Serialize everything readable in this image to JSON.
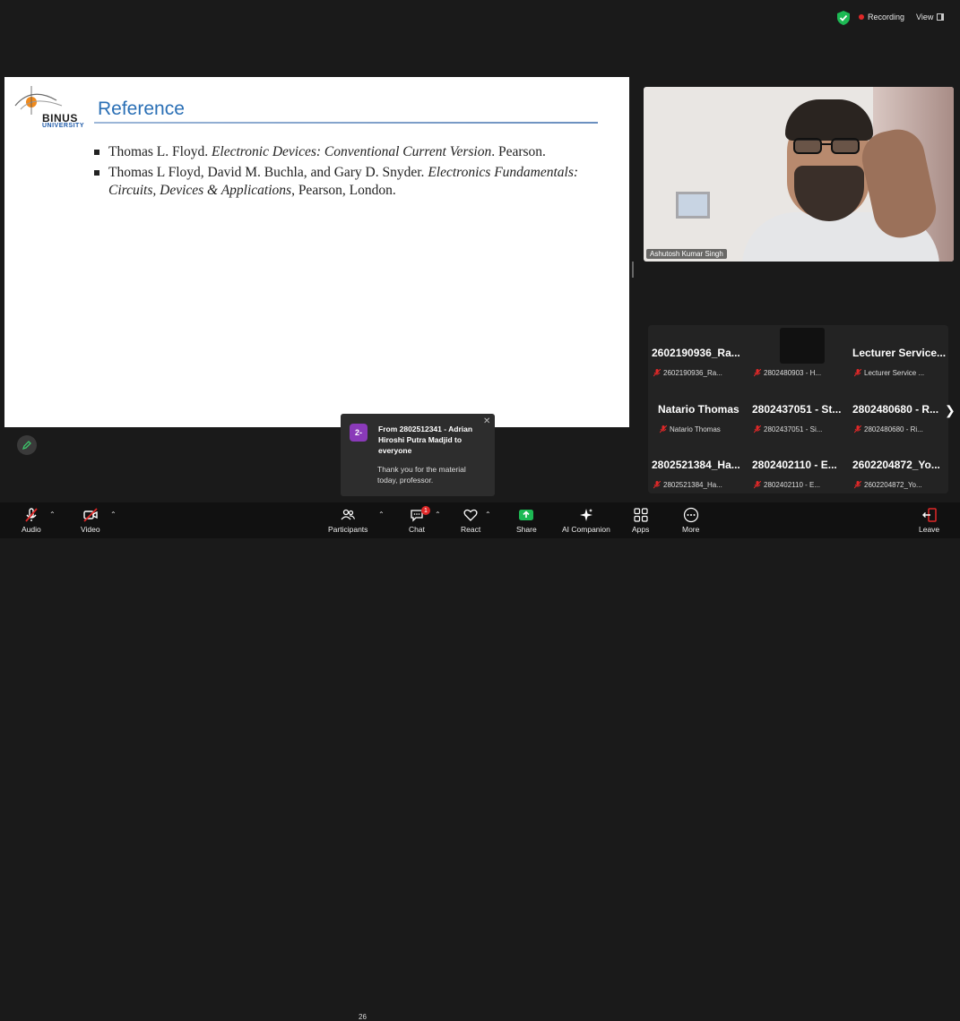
{
  "top_bar": {
    "recording_label": "Recording",
    "view_label": "View",
    "shield_color": "#1db954",
    "recording_color": "#e02828"
  },
  "slide": {
    "logo_text": "BINUS",
    "logo_sub": "UNIVERSITY",
    "title": "Reference",
    "references": [
      {
        "pre": "Thomas L. Floyd. ",
        "italic": "Electronic Devices: Conventional Current Version",
        "post": ". Pearson."
      },
      {
        "pre": "Thomas L Floyd, David M. Buchla, and Gary D. Snyder. ",
        "italic": "Electronics Fundamentals: Circuits, Devices & Applications",
        "post": ", Pearson, London."
      }
    ]
  },
  "video": {
    "name": "Ashutosh Kumar Singh"
  },
  "gallery": {
    "tiles": [
      {
        "name": "2602190936_Ra...",
        "footer": "2602190936_Ra..."
      },
      {
        "name": "",
        "footer": "2802480903 - H..."
      },
      {
        "name": "Lecturer Service...",
        "footer": "Lecturer Service ..."
      },
      {
        "name": "Natario Thomas",
        "footer": "Natario Thomas"
      },
      {
        "name": "2802437051 - St...",
        "footer": "2802437051 - Si..."
      },
      {
        "name": "2802480680 - R...",
        "footer": "2802480680 - Ri..."
      },
      {
        "name": "2802521384_Ha...",
        "footer": "2802521384_Ha..."
      },
      {
        "name": "2802402110 - E...",
        "footer": "2802402110 - E..."
      },
      {
        "name": "2602204872_Yo...",
        "footer": "2602204872_Yo..."
      }
    ]
  },
  "chat_toast": {
    "avatar": "2-",
    "from": "From 2802512341 - Adrian Hiroshi Putra Madjid to everyone",
    "message": "Thank you for the material today, professor.",
    "avatar_color": "#8a3ab9"
  },
  "toolbar": {
    "audio": "Audio",
    "video": "Video",
    "participants": "Participants",
    "participant_count": "26",
    "chat": "Chat",
    "chat_badge": "1",
    "react": "React",
    "share": "Share",
    "ai_companion": "AI Companion",
    "apps": "Apps",
    "more": "More",
    "leave": "Leave",
    "share_color": "#1db954",
    "leave_color": "#e02828"
  }
}
